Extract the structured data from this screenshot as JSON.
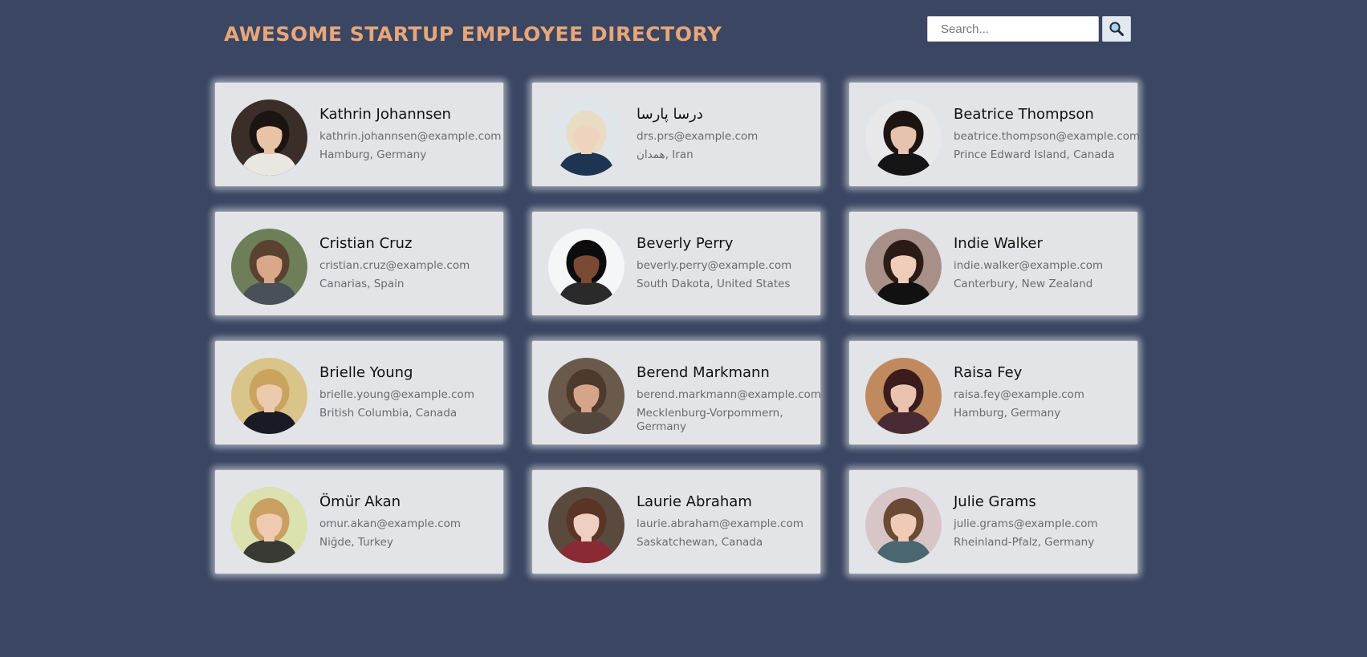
{
  "header": {
    "title": "AWESOME STARTUP EMPLOYEE DIRECTORY",
    "search_placeholder": "Search..."
  },
  "employees": [
    {
      "name": "Kathrin Johannsen",
      "email": "kathrin.johannsen@example.com",
      "location": "Hamburg, Germany",
      "bg": "#3b2e28",
      "skin": "#e8c3a6",
      "hair": "#1b1412",
      "shirt": "#eae6e1"
    },
    {
      "name": "درسا پارسا",
      "email": "drs.prs@example.com",
      "location": "همدان, Iran",
      "bg": "#dfe5e8",
      "skin": "#f0d3bf",
      "hair": "#e8dcc3",
      "shirt": "#1d3552"
    },
    {
      "name": "Beatrice Thompson",
      "email": "beatrice.thompson@example.com",
      "location": "Prince Edward Island, Canada",
      "bg": "#e8e8ea",
      "skin": "#e6c3ad",
      "hair": "#1c1412",
      "shirt": "#141414"
    },
    {
      "name": "Cristian Cruz",
      "email": "cristian.cruz@example.com",
      "location": "Canarias, Spain",
      "bg": "#6e7e58",
      "skin": "#d9a88a",
      "hair": "#5a4230",
      "shirt": "#4a5058"
    },
    {
      "name": "Beverly Perry",
      "email": "beverly.perry@example.com",
      "location": "South Dakota, United States",
      "bg": "#f4f6f8",
      "skin": "#7a4a35",
      "hair": "#0c0c0c",
      "shirt": "#2a2a2a"
    },
    {
      "name": "Indie Walker",
      "email": "indie.walker@example.com",
      "location": "Canterbury, New Zealand",
      "bg": "#a89088",
      "skin": "#efcdb8",
      "hair": "#2c1a14",
      "shirt": "#111111"
    },
    {
      "name": "Brielle Young",
      "email": "brielle.young@example.com",
      "location": "British Columbia, Canada",
      "bg": "#d9c58a",
      "skin": "#edc9ad",
      "hair": "#caa35e",
      "shirt": "#1a1a24"
    },
    {
      "name": "Berend Markmann",
      "email": "berend.markmann@example.com",
      "location": "Mecklenburg-Vorpommern, Germany",
      "bg": "#6a5a4c",
      "skin": "#d5a58a",
      "hair": "#4e3a2c",
      "shirt": "#54483e"
    },
    {
      "name": "Raisa Fey",
      "email": "raisa.fey@example.com",
      "location": "Hamburg, Germany",
      "bg": "#c08a5e",
      "skin": "#e9c2b0",
      "hair": "#3a1c1c",
      "shirt": "#4a2a34"
    },
    {
      "name": "Ömür Akan",
      "email": "omur.akan@example.com",
      "location": "Niğde, Turkey",
      "bg": "#dbe2b0",
      "skin": "#efcab0",
      "hair": "#c9a062",
      "shirt": "#3a3a34"
    },
    {
      "name": "Laurie Abraham",
      "email": "laurie.abraham@example.com",
      "location": "Saskatchewan, Canada",
      "bg": "#5a4a3e",
      "skin": "#efcfc2",
      "hair": "#5a3424",
      "shirt": "#8a2a34"
    },
    {
      "name": "Julie Grams",
      "email": "julie.grams@example.com",
      "location": "Rheinland-Pfalz, Germany",
      "bg": "#d8c5c8",
      "skin": "#efcab4",
      "hair": "#6a4a34",
      "shirt": "#4a6670"
    }
  ]
}
